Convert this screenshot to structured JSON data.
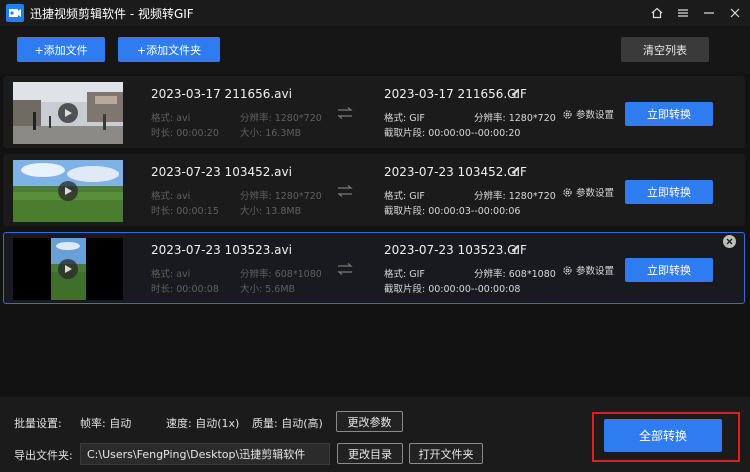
{
  "window": {
    "title": "迅捷视频剪辑软件 - 视频转GIF"
  },
  "toolbar": {
    "add_file": "+添加文件",
    "add_folder": "+添加文件夹",
    "clear_list": "清空列表"
  },
  "items": [
    {
      "source_name": "2023-03-17 211656.avi",
      "format": "格式: avi",
      "duration": "时长: 00:00:20",
      "resolution": "分辨率: 1280*720",
      "size": "大小: 16.3MB",
      "output_name": "2023-03-17 211656.GIF",
      "output_format": "格式: GIF",
      "output_resolution": "分辨率: 1280*720",
      "clip": "截取片段: 00:00:00--00:00:20",
      "params_label": "参数设置",
      "convert_label": "立即转换",
      "thumb": "street"
    },
    {
      "source_name": "2023-07-23 103452.avi",
      "format": "格式: avi",
      "duration": "时长: 00:00:15",
      "resolution": "分辨率: 1280*720",
      "size": "大小: 13.8MB",
      "output_name": "2023-07-23 103452.GIF",
      "output_format": "格式: GIF",
      "output_resolution": "分辨率: 1280*720",
      "clip": "截取片段: 00:00:03--00:00:06",
      "params_label": "参数设置",
      "convert_label": "立即转换",
      "thumb": "field"
    },
    {
      "source_name": "2023-07-23 103523.avi",
      "format": "格式: avi",
      "duration": "时长: 00:00:08",
      "resolution": "分辨率: 608*1080",
      "size": "大小: 5.6MB",
      "output_name": "2023-07-23 103523.GIF",
      "output_format": "格式: GIF",
      "output_resolution": "分辨率: 608*1080",
      "clip": "截取片段: 00:00:00--00:00:08",
      "params_label": "参数设置",
      "convert_label": "立即转换",
      "thumb": "portrait"
    }
  ],
  "batch": {
    "label": "批量设置:",
    "fps": "帧率: 自动",
    "speed": "速度: 自动(1x)",
    "quality": "质量: 自动(高)",
    "change_params": "更改参数"
  },
  "export": {
    "label": "导出文件夹:",
    "path": "C:\\Users\\FengPing\\Desktop\\迅捷剪辑软件",
    "change_dir": "更改目录",
    "open_folder": "打开文件夹"
  },
  "convert_all": "全部转换",
  "colors": {
    "accent": "#2f7cf1",
    "highlight": "#e01e1e",
    "selected_border": "#2f6fd8"
  }
}
